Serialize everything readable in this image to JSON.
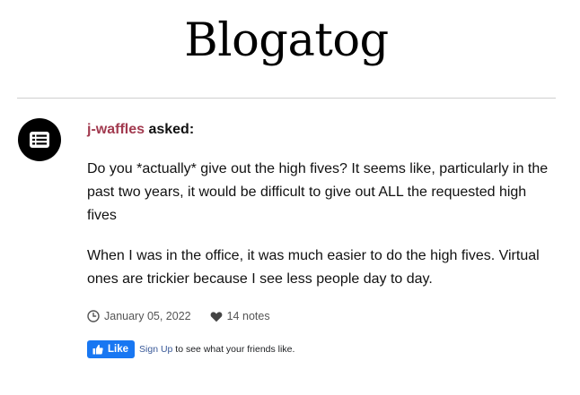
{
  "blog": {
    "title": "Blogatog"
  },
  "post": {
    "asker": "j-waffles",
    "asked_suffix": " asked:",
    "paragraphs": [
      "Do you *actually* give out the high fives? It seems like, particularly in the past two years, it would be difficult to give out ALL the requested high fives",
      "When I was in the office, it was much easier to do the high fives. Virtual ones are trickier because I see less people day to day."
    ],
    "date": "January 05, 2022",
    "notes": "14 notes",
    "avatar_icon": "list-icon",
    "date_icon": "clock-icon",
    "notes_icon": "heart-icon"
  },
  "social": {
    "like_label": "Like",
    "like_icon": "thumbs-up-icon",
    "signup_label": "Sign Up",
    "signup_suffix": " to see what your friends like.",
    "like_color": "#1877f2"
  },
  "colors": {
    "asker_name": "#a23a4f",
    "divider": "#cfcfcf"
  }
}
